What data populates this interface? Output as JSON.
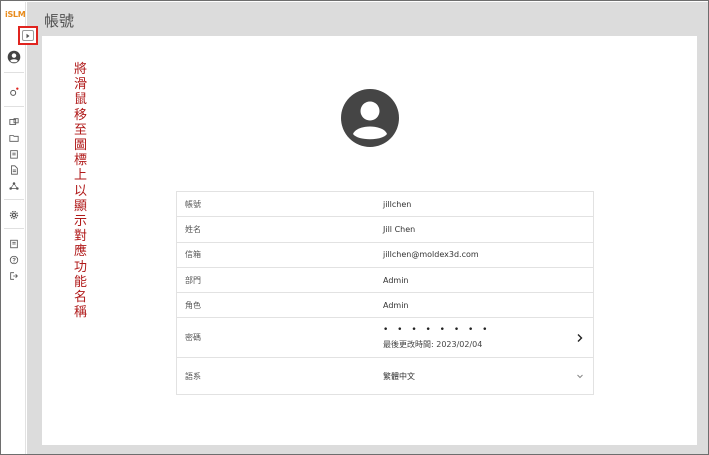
{
  "sidebar": {
    "logo": "iSLM",
    "icons": [
      "expand-icon",
      "user-icon",
      "sprocket-icon",
      "gallery-icon",
      "folder-icon",
      "clipboard-icon",
      "document-icon",
      "network-icon",
      "settings-icon",
      "book-icon",
      "help-icon",
      "logout-icon"
    ]
  },
  "header": {
    "title": "帳號"
  },
  "annotation": "將滑鼠移至圖標上以顯示對應功能名稱",
  "account": {
    "rows": [
      {
        "label": "帳號",
        "value": "jillchen"
      },
      {
        "label": "姓名",
        "value": "Jill Chen"
      },
      {
        "label": "信箱",
        "value": "jillchen@moldex3d.com"
      },
      {
        "label": "部門",
        "value": "Admin"
      },
      {
        "label": "角色",
        "value": "Admin"
      }
    ],
    "password": {
      "label": "密碼",
      "value": "• • • • • • • •",
      "last_changed": "最後更改時間: 2023/02/04"
    },
    "language": {
      "label": "語系",
      "value": "繁體中文"
    }
  },
  "colors": {
    "annotation": "#b01a1a",
    "highlight": "#e0241f",
    "logo": "#e88b1c",
    "background": "#dcdcdc"
  }
}
